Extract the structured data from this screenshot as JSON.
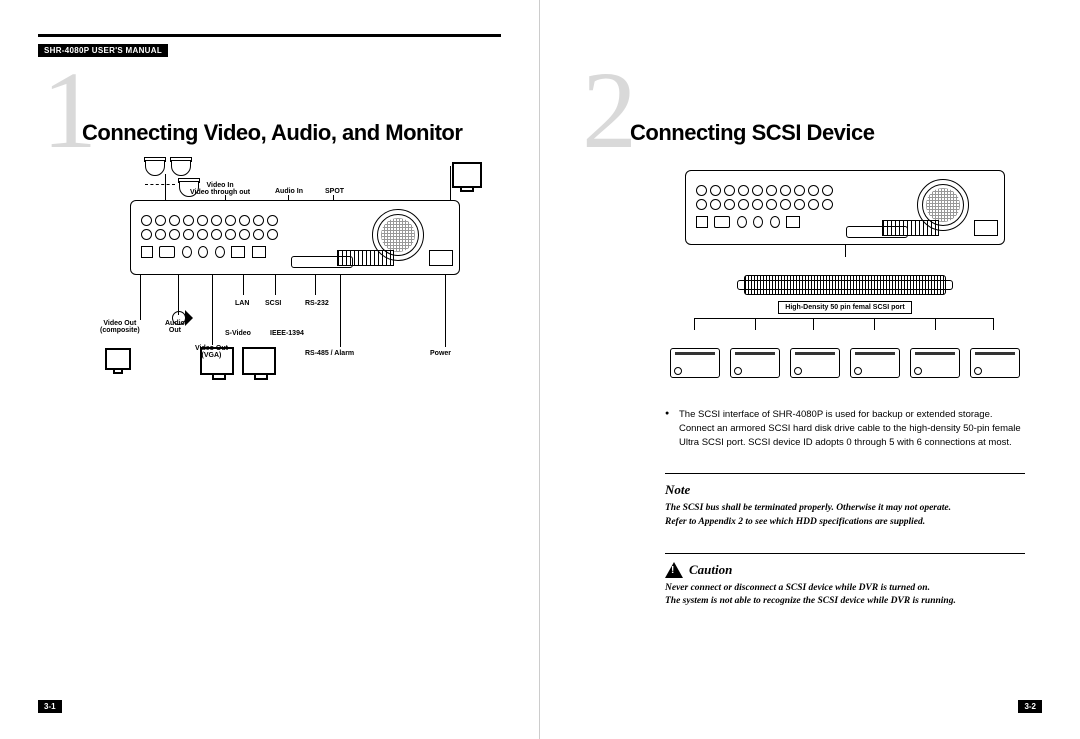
{
  "header": {
    "manual_title": "SHR-4080P USER'S MANUAL"
  },
  "left": {
    "number": "1",
    "title": "Connecting Video, Audio, and Monitor",
    "labels": {
      "video_in": "Video In",
      "video_through": "Video through out",
      "audio_in": "Audio In",
      "spot": "SPOT",
      "video_out_comp": "Video Out\n(composite)",
      "audio_out": "Audio\nOut",
      "video_out_vga": "Video Out\n(VGA)",
      "s_video": "S-Video",
      "lan": "LAN",
      "scsi": "SCSI",
      "ieee1394": "IEEE-1394",
      "rs232": "RS-232",
      "rs485": "RS-485 / Alarm",
      "power": "Power"
    },
    "page_number": "3-1"
  },
  "right": {
    "number": "2",
    "title": "Connecting SCSI Device",
    "scsi_port_label": "High-Density 50 pin femal SCSI port",
    "bullet": "The SCSI interface of SHR-4080P is used for backup or extended storage. Connect an armored SCSI hard disk drive cable to the high-density 50-pin female Ultra SCSI port. SCSI device ID adopts 0 through 5 with 6 connections at most.",
    "note": {
      "title": "Note",
      "body": "The SCSI bus shall be terminated properly. Otherwise it may not operate.\nRefer to Appendix 2 to see which HDD specifications are supplied."
    },
    "caution": {
      "title": "Caution",
      "body": "Never connect or disconnect a SCSI device while DVR is turned on.\nThe system is not able to recognize the SCSI device while DVR is running."
    },
    "page_number": "3-2"
  }
}
